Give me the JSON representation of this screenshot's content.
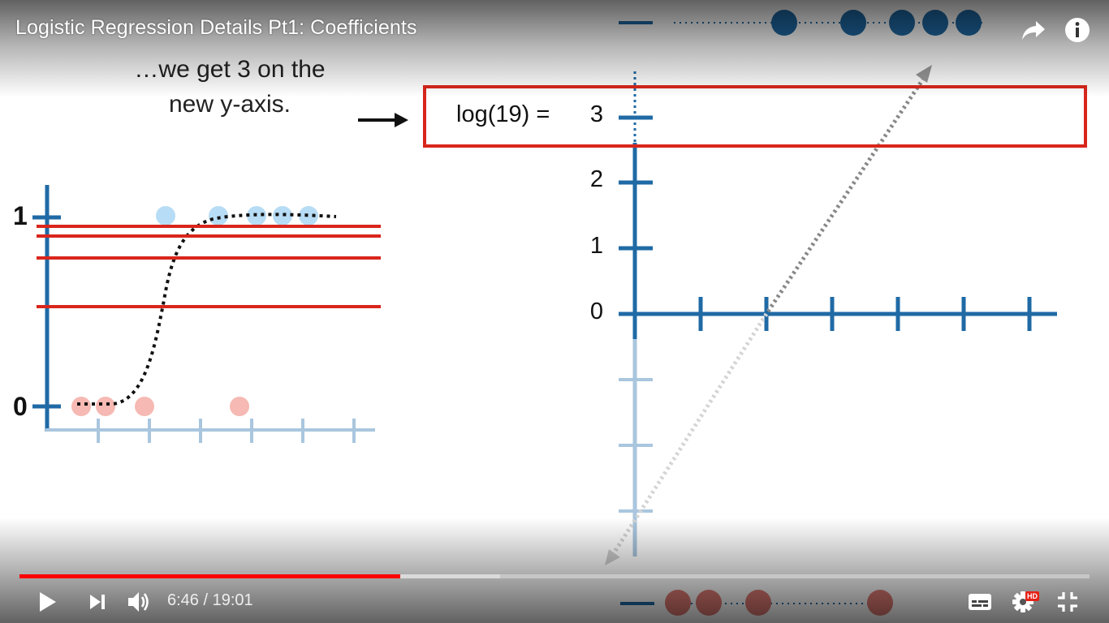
{
  "header": {
    "title": "Logistic Regression Details Pt1: Coefficients",
    "share_icon": "share-arrow-icon",
    "info_icon": "info-icon"
  },
  "slide": {
    "caption_line1": "…we get 3 on the",
    "caption_line2": "new y-axis.",
    "highlight_label": "log(19) =",
    "right_axis_ticks": [
      "3",
      "2",
      "1",
      "0"
    ],
    "left_axis_ticks": [
      "1",
      "0"
    ],
    "colors": {
      "axis_blue": "#1f6aa5",
      "faded_blue": "#a9c6de",
      "highlight_red": "#d9261c",
      "point_blue": "#b7dcf5",
      "point_red": "#f6b9b3"
    }
  },
  "player": {
    "current_time": "6:46",
    "separator": " / ",
    "duration": "19:01",
    "progress_fraction": 0.356,
    "buffered_fraction": 0.449,
    "hd_badge": "HD",
    "controls": {
      "play": "play-icon",
      "next": "next-icon",
      "volume": "volume-icon",
      "subtitles": "subtitles-icon",
      "settings": "gear-icon",
      "fullscreen": "exit-fullscreen-icon"
    }
  }
}
